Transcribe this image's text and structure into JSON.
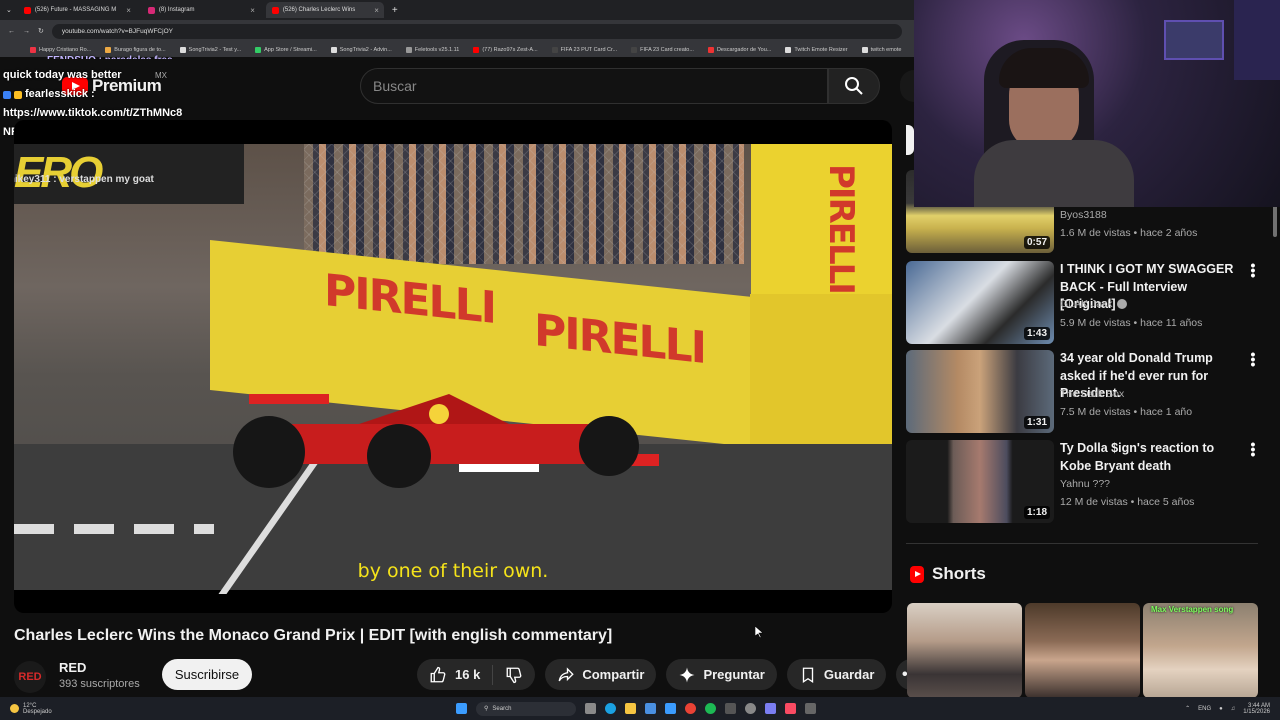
{
  "browser": {
    "tabs": [
      {
        "title": "(526) Future - MASSAGING M",
        "active": false,
        "color": "#ff0000"
      },
      {
        "title": "(8) Instagram",
        "active": false,
        "color": "#d62976"
      },
      {
        "title": "(526) Charles Leclerc Wins",
        "active": true,
        "color": "#ff0000"
      }
    ],
    "url": "youtube.com/watch?v=BJFuqWFCjOY",
    "bookmarks": [
      "Happy Cristiano Ro...",
      "Burago figura de to...",
      "SongTrivia2 - Test y...",
      "App Store / Streami...",
      "SongTrivia2 - Advin...",
      "Feletools v25.1.11",
      "(77) Razo97s Zest-A...",
      "FIFA 23 PUT Card Cr...",
      "FIFA 23 Card creato...",
      "Descargador de You...",
      "Twitch Emote Resizer",
      "twitch emote"
    ]
  },
  "stream_chat": {
    "lines": [
      "quick today was better",
      "fearlesskick :",
      "https://www.tiktok.com/t/ZThMNc8",
      "NR/"
    ],
    "overlay_top": "FENDSUO : paradelas free",
    "video_overlay": "mikey311 : verstappen my goat"
  },
  "youtube": {
    "logo_text": "Premium",
    "country": "MX",
    "search_placeholder": "Buscar",
    "video": {
      "subtitle": "by one of their own.",
      "banner_left": "ERO",
      "banner_brand": "PIRELLI",
      "title": "Charles Leclerc Wins the Monaco Grand Prix | EDIT [with english commentary]",
      "channel": "RED",
      "channel_initials": "RED",
      "subscribers": "393 suscriptores",
      "subscribe_label": "Suscribirse",
      "likes": "16 k",
      "share_label": "Compartir",
      "ask_label": "Preguntar",
      "save_label": "Guardar"
    },
    "recommendations": [
      {
        "title": "",
        "channel": "Byos3188",
        "meta": "1.6 M de vistas • hace 2 años",
        "duration": "0:57",
        "verified": false
      },
      {
        "title": "I THINK I GOT MY SWAGGER BACK - Full Interview [Original]",
        "channel": "GLAK Jack",
        "meta": "5.9 M de vistas • hace 11 años",
        "duration": "1:43",
        "verified": true
      },
      {
        "title": "34 year old Donald Trump asked if he'd ever run for President.",
        "channel": "The Dark Box",
        "meta": "7.5 M de vistas • hace 1 año",
        "duration": "1:31",
        "verified": false
      },
      {
        "title": "Ty Dolla $ign's reaction to Kobe Bryant death",
        "channel": "Yahnu ???",
        "meta": "12 M de vistas • hace 5 años",
        "duration": "1:18",
        "verified": false
      }
    ],
    "shorts_heading": "Shorts",
    "shorts": [
      {
        "caption": ""
      },
      {
        "caption": ""
      },
      {
        "caption": "Max Verstappen song"
      }
    ]
  },
  "taskbar": {
    "weather_temp": "12°C",
    "weather_desc": "Despejado",
    "search_label": "Search",
    "lang": "ENG",
    "time": "3:44 AM",
    "date": "1/15/2026"
  }
}
